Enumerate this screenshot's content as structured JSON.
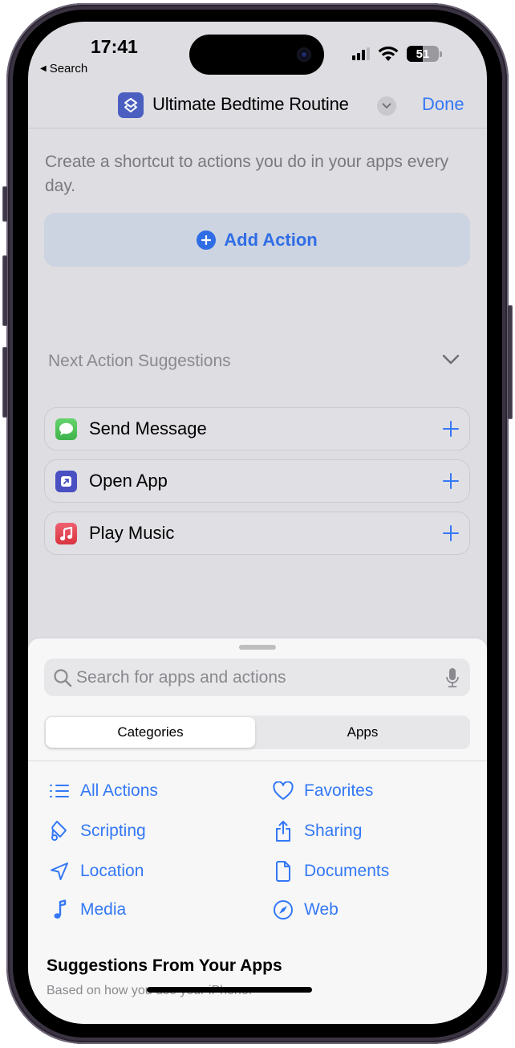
{
  "status_bar": {
    "time": "17:41",
    "back_label": "Search",
    "battery_level": "51",
    "battery_fraction": 0.51
  },
  "nav": {
    "title": "Ultimate Bedtime Routine",
    "done_label": "Done",
    "icon": "shortcuts-layers-icon"
  },
  "main": {
    "intro": "Create a shortcut to actions you do in your apps every day.",
    "add_action_label": "Add Action",
    "suggestions_header": "Next Action Suggestions",
    "suggestions": [
      {
        "label": "Send Message",
        "icon": "messages-app-icon",
        "color": "#4cc35a"
      },
      {
        "label": "Open App",
        "icon": "open-app-icon",
        "color": "#4a4fc2"
      },
      {
        "label": "Play Music",
        "icon": "music-app-icon",
        "color": "#e0404e"
      }
    ]
  },
  "sheet": {
    "search_placeholder": "Search for apps and actions",
    "search_value": "",
    "segments": [
      {
        "label": "Categories",
        "selected": true
      },
      {
        "label": "Apps",
        "selected": false
      }
    ],
    "categories": [
      {
        "label": "All Actions",
        "icon": "list-icon"
      },
      {
        "label": "Favorites",
        "icon": "heart-icon"
      },
      {
        "label": "Scripting",
        "icon": "scroll-icon"
      },
      {
        "label": "Sharing",
        "icon": "share-icon"
      },
      {
        "label": "Location",
        "icon": "location-arrow-icon"
      },
      {
        "label": "Documents",
        "icon": "document-icon"
      },
      {
        "label": "Media",
        "icon": "music-note-icon"
      },
      {
        "label": "Web",
        "icon": "compass-icon"
      }
    ],
    "apps_section_title": "Suggestions From Your Apps",
    "apps_section_subtitle": "Based on how you use your iPhone."
  },
  "colors": {
    "accent": "#3478f6",
    "screen_bg": "#dedde2",
    "sheet_bg": "#f7f7f7"
  }
}
